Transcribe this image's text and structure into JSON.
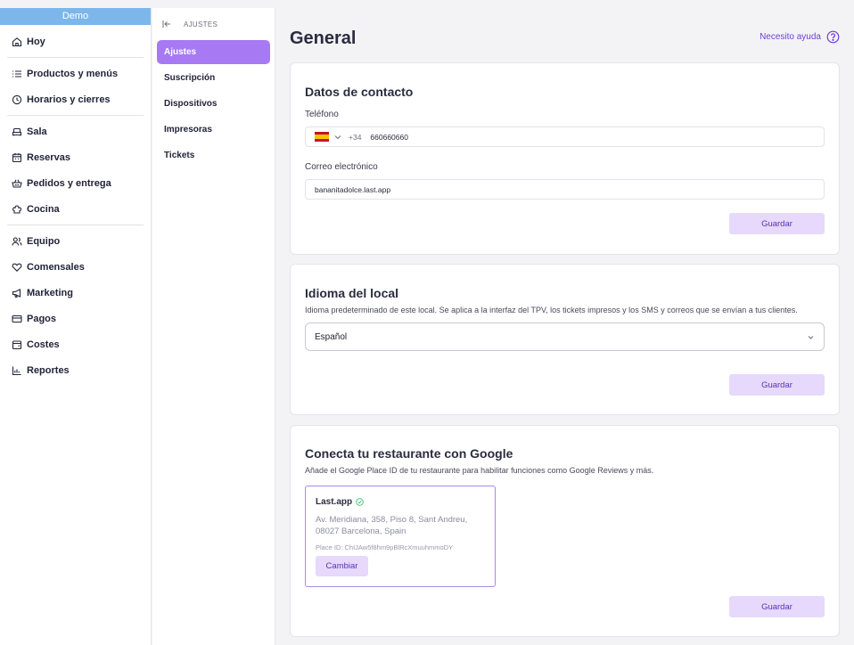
{
  "sidebar": {
    "demo_label": "Demo",
    "items": [
      {
        "label": "Hoy",
        "icon": "home-icon"
      },
      {
        "label": "Productos y menús",
        "icon": "list-icon"
      },
      {
        "label": "Horarios y cierres",
        "icon": "clock-icon"
      },
      {
        "label": "Sala",
        "icon": "sofa-icon"
      },
      {
        "label": "Reservas",
        "icon": "calendar-icon"
      },
      {
        "label": "Pedidos y entrega",
        "icon": "basket-icon"
      },
      {
        "label": "Cocina",
        "icon": "chef-hat-icon"
      },
      {
        "label": "Equipo",
        "icon": "users-icon"
      },
      {
        "label": "Comensales",
        "icon": "heart-icon"
      },
      {
        "label": "Marketing",
        "icon": "megaphone-icon"
      },
      {
        "label": "Pagos",
        "icon": "credit-card-icon"
      },
      {
        "label": "Costes",
        "icon": "wallet-icon"
      },
      {
        "label": "Reportes",
        "icon": "chart-icon"
      }
    ]
  },
  "submenu": {
    "header": "AJUSTES",
    "items": [
      {
        "label": "Ajustes",
        "active": true
      },
      {
        "label": "Suscripción",
        "active": false
      },
      {
        "label": "Dispositivos",
        "active": false
      },
      {
        "label": "Impresoras",
        "active": false
      },
      {
        "label": "Tickets",
        "active": false
      }
    ]
  },
  "main": {
    "title": "General",
    "help": "Necesito ayuda"
  },
  "contact": {
    "title": "Datos de contacto",
    "phone_label": "Teléfono",
    "phone_prefix": "+34",
    "phone_value": "660660660",
    "email_label": "Correo electrónico",
    "email_value": "bananitadolce.last.app",
    "save": "Guardar"
  },
  "language": {
    "title": "Idioma del local",
    "description": "Idioma predeterminado de este local. Se aplica a la interfaz del TPV, los tickets impresos y los SMS y correos que se envían a tus clientes.",
    "selected": "Español",
    "save": "Guardar"
  },
  "google": {
    "title": "Conecta tu restaurante con Google",
    "description": "Añade el Google Place ID de tu restaurante para habilitar funciones como Google Reviews y más.",
    "place_name": "Last.app",
    "place_address": "Av. Meridiana, 358, Piso 8, Sant Andreu, 08027 Barcelona, Spain",
    "place_id": "Place ID: ChIJAw5f8hm9pBlRcXmuuhmmoDY",
    "change": "Cambiar",
    "save": "Guardar"
  },
  "colors": {
    "accent": "#a77af3",
    "accent_text": "#5b30b8",
    "button_bg": "#e6d9fb",
    "demo_bar": "#7db6ea"
  }
}
